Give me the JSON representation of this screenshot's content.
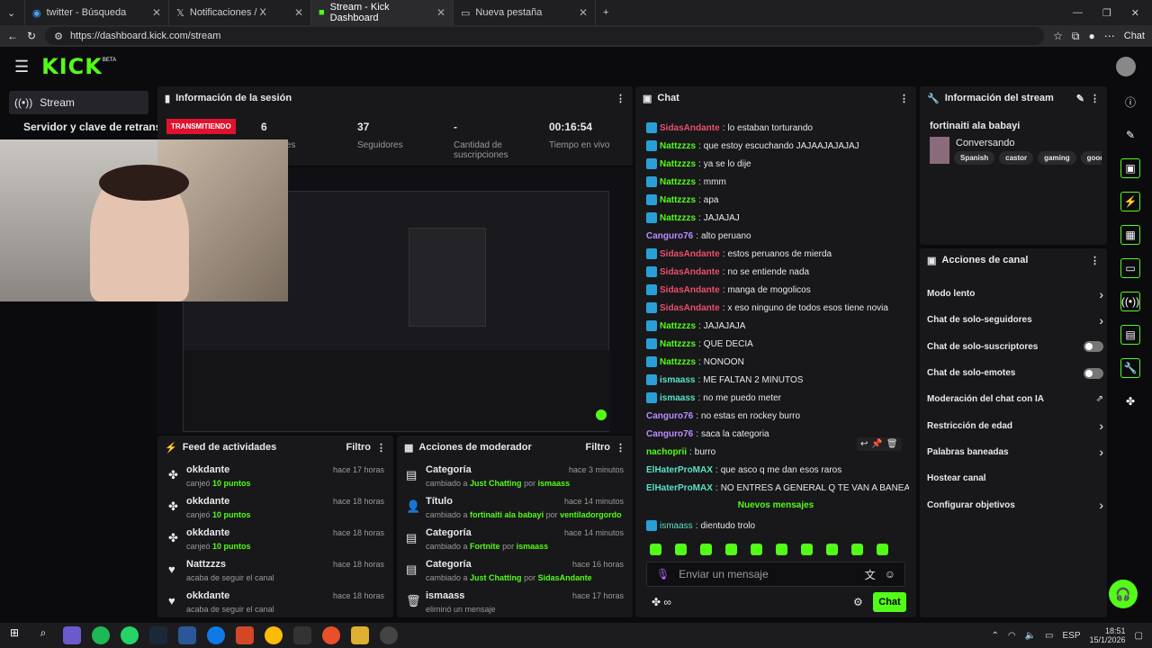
{
  "browser": {
    "tabs": [
      {
        "label": "twitter - Búsqueda"
      },
      {
        "label": "Notificaciones / X"
      },
      {
        "label": "Stream - Kick Dashboard"
      },
      {
        "label": "Nueva pestaña"
      }
    ],
    "url": "https://dashboard.kick.com/stream"
  },
  "nav": {
    "logo": "KICK",
    "beta": "BETA"
  },
  "sidebar": {
    "stream": "Stream",
    "server": "Servidor y clave de retransm"
  },
  "session": {
    "title": "Información de la sesión",
    "live_badge": "TRANSMITIENDO",
    "stats": [
      {
        "value": "6",
        "label": "ctadores"
      },
      {
        "value": "37",
        "label": "Seguidores"
      },
      {
        "value": "-",
        "label": "Cantidad de suscripciones"
      },
      {
        "value": "00:16:54",
        "label": "Tiempo en vivo"
      }
    ]
  },
  "feed": {
    "title": "Feed de actividades",
    "filter": "Filtro",
    "items": [
      {
        "user": "okkdante",
        "pre": "canjeó",
        "hl": "10 puntos",
        "time": "hace 17 horas"
      },
      {
        "user": "okkdante",
        "pre": "canjeó",
        "hl": "10 puntos",
        "time": "hace 18 horas"
      },
      {
        "user": "okkdante",
        "pre": "canjeó",
        "hl": "10 puntos",
        "time": "hace 18 horas"
      },
      {
        "user": "Nattzzzs",
        "pre": "acaba de seguir el canal",
        "hl": "",
        "time": "hace 18 horas"
      },
      {
        "user": "okkdante",
        "pre": "acaba de seguir el canal",
        "hl": "",
        "time": "hace 18 horas"
      }
    ]
  },
  "mod": {
    "title": "Acciones de moderador",
    "filter": "Filtro",
    "items": [
      {
        "title": "Categoría",
        "pre": "cambiado a",
        "v": "Just Chatting",
        "by": "por",
        "u": "ismaass",
        "time": "hace 3 minutos"
      },
      {
        "title": "Título",
        "pre": "cambiado a",
        "v": "fortinaiti ala babayi",
        "by": "por",
        "u": "ventiladorgordo",
        "time": "hace 14 minutos"
      },
      {
        "title": "Categoría",
        "pre": "cambiado a",
        "v": "Fortnite",
        "by": "por",
        "u": "ismaass",
        "time": "hace 14 minutos"
      },
      {
        "title": "Categoría",
        "pre": "cambiado a",
        "v": "Just Chatting",
        "by": "por",
        "u": "SidasAndante",
        "time": "hace 16 horas"
      },
      {
        "title": "ismaass",
        "pre": "eliminó un mensaje",
        "v": "",
        "by": "",
        "u": "",
        "time": "hace 17 horas"
      }
    ]
  },
  "chat": {
    "title": "Chat",
    "messages": [
      {
        "u": "SidasAndante",
        "c": "u-red",
        "b": true,
        "t": "lo estaban torturando"
      },
      {
        "u": "Nattzzzs",
        "c": "u-green",
        "b": true,
        "t": "que estoy escuchando JAJAAJAJAJAJ"
      },
      {
        "u": "Nattzzzs",
        "c": "u-green",
        "b": true,
        "t": "ya se lo dije"
      },
      {
        "u": "Nattzzzs",
        "c": "u-green",
        "b": true,
        "t": "mmm"
      },
      {
        "u": "Nattzzzs",
        "c": "u-green",
        "b": true,
        "t": "apa"
      },
      {
        "u": "Nattzzzs",
        "c": "u-green",
        "b": true,
        "t": "JAJAJAJ"
      },
      {
        "u": "Canguro76",
        "c": "u-purple",
        "b": false,
        "t": "alto peruano"
      },
      {
        "u": "SidasAndante",
        "c": "u-red",
        "b": true,
        "t": "estos peruanos de mierda"
      },
      {
        "u": "SidasAndante",
        "c": "u-red",
        "b": true,
        "t": "no se entiende nada"
      },
      {
        "u": "SidasAndante",
        "c": "u-red",
        "b": true,
        "t": "manga de mogolicos"
      },
      {
        "u": "SidasAndante",
        "c": "u-red",
        "b": true,
        "t": "x eso ninguno de todos esos tiene novia"
      },
      {
        "u": "Nattzzzs",
        "c": "u-green",
        "b": true,
        "t": "JAJAJAJA"
      },
      {
        "u": "Nattzzzs",
        "c": "u-green",
        "b": true,
        "t": "QUE DECIA"
      },
      {
        "u": "Nattzzzs",
        "c": "u-green",
        "b": true,
        "t": "NONOON"
      },
      {
        "u": "ismaass",
        "c": "u-teal",
        "b": true,
        "t": "ME FALTAN 2 MINUTOS"
      },
      {
        "u": "ismaass",
        "c": "u-teal",
        "b": true,
        "t": "no me puedo meter"
      },
      {
        "u": "Canguro76",
        "c": "u-purple",
        "b": false,
        "t": "no estas en rockey burro"
      },
      {
        "u": "Canguro76",
        "c": "u-purple",
        "b": false,
        "t": "saca la categoria"
      },
      {
        "u": "nachoprii",
        "c": "u-green",
        "b": false,
        "t": "burro"
      },
      {
        "u": "ElHaterProMAX",
        "c": "u-teal",
        "b": false,
        "t": "que asco q me dan esos raros"
      },
      {
        "u": "ElHaterProMAX",
        "c": "u-teal",
        "b": false,
        "t": "NO ENTRES A GENERAL Q TE VAN A BANEAR"
      }
    ],
    "new_messages": "Nuevos mensajes",
    "last": {
      "u": "ismaass",
      "t": "dientudo trolo"
    },
    "placeholder": "Enviar un mensaje",
    "send": "Chat"
  },
  "stream_info": {
    "title": "Información del stream",
    "stream_title": "fortinaiti ala babayi",
    "category": "Conversando",
    "tags": [
      "Spanish",
      "castor",
      "gaming",
      "goodb"
    ]
  },
  "channel": {
    "title": "Acciones de canal",
    "items": [
      {
        "label": "Modo lento",
        "kind": "chev"
      },
      {
        "label": "Chat de solo-seguidores",
        "kind": "chev"
      },
      {
        "label": "Chat de solo-suscriptores",
        "kind": "toggle"
      },
      {
        "label": "Chat de solo-emotes",
        "kind": "toggle"
      },
      {
        "label": "Moderación del chat con IA",
        "kind": "ext"
      },
      {
        "label": "Restricción de edad",
        "kind": "chev"
      },
      {
        "label": "Palabras baneadas",
        "kind": "chev"
      },
      {
        "label": "Hostear canal",
        "kind": "none"
      },
      {
        "label": "Configurar objetivos",
        "kind": "chev"
      }
    ]
  },
  "taskbar": {
    "lang": "ESP",
    "time": "18:51",
    "date": "15/1/2026"
  },
  "colors": {
    "accent": "#53fc18",
    "panel": "#18181b",
    "live": "#e0132f"
  }
}
